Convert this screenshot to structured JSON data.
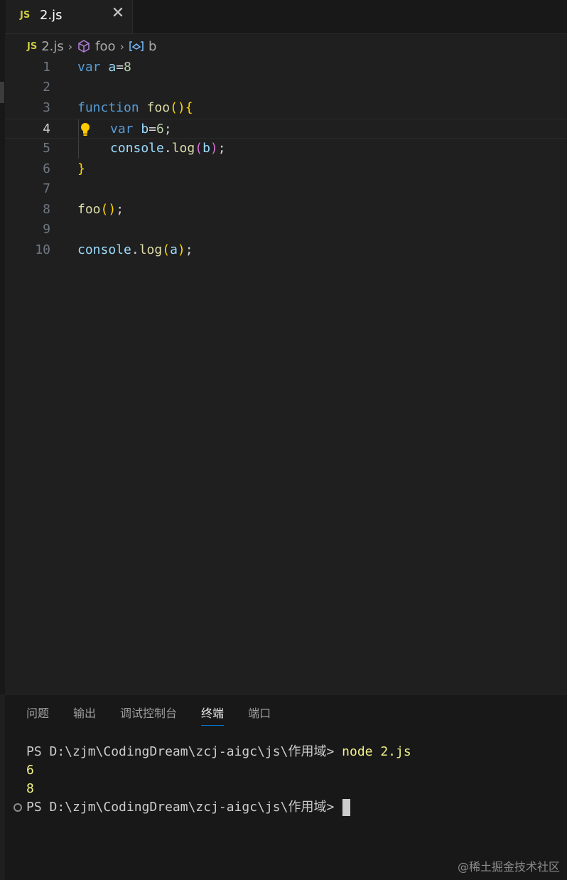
{
  "tab": {
    "badge": "JS",
    "filename": "2.js",
    "close_glyph": "✕"
  },
  "breadcrumb": {
    "badge": "JS",
    "file": "2.js",
    "function": "foo",
    "variable": "b"
  },
  "editor": {
    "line_numbers": [
      "1",
      "2",
      "3",
      "4",
      "5",
      "6",
      "7",
      "8",
      "9",
      "10"
    ],
    "active_line": 4
  },
  "panel": {
    "tabs": [
      "问题",
      "输出",
      "调试控制台",
      "终端",
      "端口"
    ],
    "active_tab": "终端"
  },
  "terminal": {
    "prompt": "PS D:\\zjm\\CodingDream\\zcj-aigc\\js\\作用域>",
    "command": "node 2.js",
    "output": [
      "6",
      "8"
    ]
  },
  "watermark": "@稀土掘金技术社区",
  "colors": {
    "background": "#1f1f1f",
    "keyword": "#569cd6",
    "identifier": "#9cdcfe",
    "function": "#dcdcaa",
    "number": "#b5cea8",
    "bracket1": "#ffd700",
    "bracket2": "#da70d6",
    "active_tab_underline": "#0078d4",
    "terminal_yellow": "#f1f18c"
  }
}
